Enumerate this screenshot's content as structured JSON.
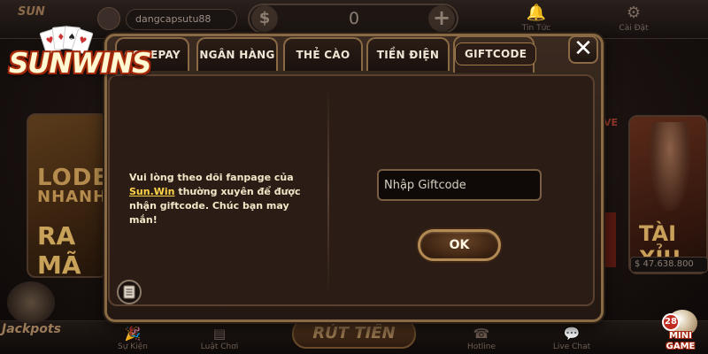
{
  "app": {
    "username": "dangcapsutu88",
    "balance": "0",
    "top_icons": [
      {
        "icon": "bell-icon",
        "label": "Tin Tức"
      },
      {
        "icon": "gear-icon",
        "label": "Cài Đặt"
      }
    ]
  },
  "background": {
    "left_card_line1": "LODE",
    "left_card_line2": "NHANH",
    "left_card_line3": "RA MÃ",
    "right_card_title": "TÀI XỈU",
    "right_card_jackpot": "$ 47.638.800",
    "live_tag": "VE",
    "withdraw_button": "RÚT TIỀN",
    "jackpots_label": "Jackpots",
    "bottom_items": [
      {
        "icon": "party-icon",
        "label": "Sự Kiện"
      },
      {
        "icon": "rules-icon",
        "label": "Luật Chơi"
      },
      {
        "icon": "phone-icon",
        "label": "Hotline"
      },
      {
        "icon": "chat-icon",
        "label": "Live Chat"
      }
    ],
    "minigame_count": "28",
    "minigame_line1": "MINI",
    "minigame_line2": "GAME"
  },
  "logo": {
    "text": "SUNWINS"
  },
  "modal": {
    "tabs": [
      {
        "label": "CODEPAY",
        "active": false
      },
      {
        "label": "NGÂN HÀNG",
        "active": false
      },
      {
        "label": "THẺ CÀO",
        "active": false
      },
      {
        "label": "TIỀN ĐIỆN TỬ",
        "active": false
      },
      {
        "label": "GIFTCODE",
        "active": true
      }
    ],
    "close_label": "✕",
    "info": {
      "part1": "Vui lòng theo dõi fanpage của ",
      "fanpage": "Sun.Win",
      "part2": " thường xuyên để được nhận giftcode. Chúc bạn may mắn!"
    },
    "giftcode_input": {
      "value": "",
      "placeholder": "Nhập Giftcode"
    },
    "ok_label": "OK"
  },
  "colors": {
    "accent_gold": "#8a6a44",
    "fanpage_link": "#ffd54a",
    "modal_bg": "#2b1c15"
  }
}
